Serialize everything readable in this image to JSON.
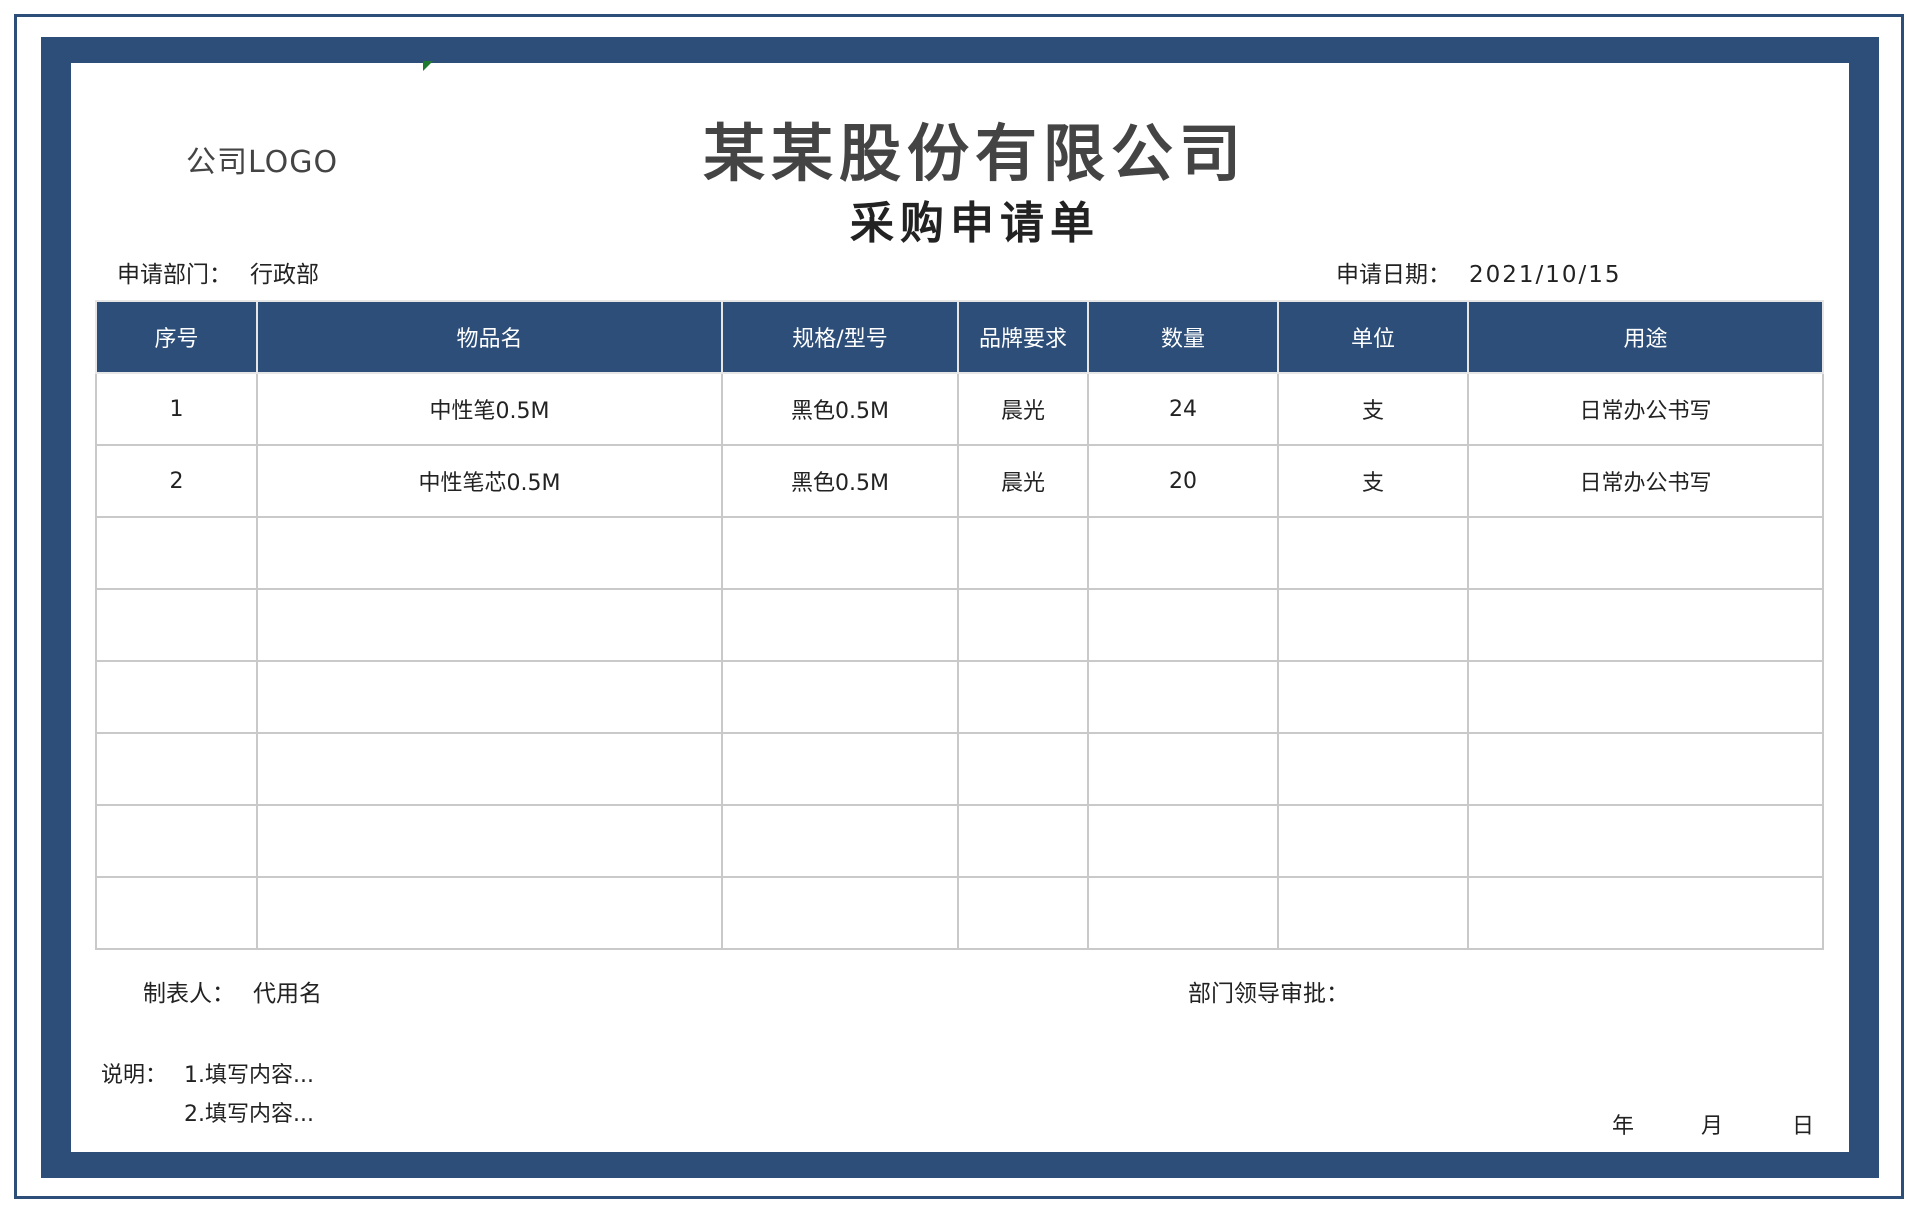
{
  "logo": "公司LOGO",
  "company_name": "某某股份有限公司",
  "form_title": "采购申请单",
  "department": {
    "label": "申请部门：",
    "value": "行政部"
  },
  "apply_date": {
    "label": "申请日期：",
    "value": "2021/10/15"
  },
  "table": {
    "headers": [
      "序号",
      "物品名",
      "规格/型号",
      "品牌要求",
      "数量",
      "单位",
      "用途"
    ],
    "rows": [
      [
        "1",
        "中性笔0.5M",
        "黑色0.5M",
        "晨光",
        "24",
        "支",
        "日常办公书写"
      ],
      [
        "2",
        "中性笔芯0.5M",
        "黑色0.5M",
        "晨光",
        "20",
        "支",
        "日常办公书写"
      ],
      [
        "",
        "",
        "",
        "",
        "",
        "",
        ""
      ],
      [
        "",
        "",
        "",
        "",
        "",
        "",
        ""
      ],
      [
        "",
        "",
        "",
        "",
        "",
        "",
        ""
      ],
      [
        "",
        "",
        "",
        "",
        "",
        "",
        ""
      ],
      [
        "",
        "",
        "",
        "",
        "",
        "",
        ""
      ],
      [
        "",
        "",
        "",
        "",
        "",
        "",
        ""
      ]
    ]
  },
  "maker": {
    "label": "制表人：",
    "value": "代用名"
  },
  "approval": {
    "label": "部门领导审批：",
    "value": ""
  },
  "notes": {
    "label": "说明：",
    "items": [
      "1.填写内容...",
      "2.填写内容..."
    ]
  },
  "date_footer": {
    "year": "年",
    "month": "月",
    "day": "日"
  },
  "colors": {
    "frame": "#2d4e78",
    "header_bg": "#2d4e78",
    "grid": "#c9c9c9"
  }
}
